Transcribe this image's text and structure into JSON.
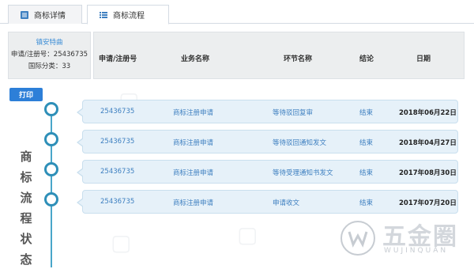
{
  "tabs": [
    {
      "label": "商标详情",
      "icon": "document-icon"
    },
    {
      "label": "商标流程",
      "icon": "list-icon"
    }
  ],
  "info": {
    "agent": "镇安特曲",
    "reg_label": "申请/注册号：25436735",
    "class_label": "国际分类：33"
  },
  "headers": {
    "number": "申请/注册号",
    "business": "业务名称",
    "step": "环节名称",
    "result": "结论",
    "date": "日期"
  },
  "print_label": "打印",
  "side_title": [
    "商",
    "标",
    "流",
    "程",
    "状",
    "态"
  ],
  "rows": [
    {
      "number": "25436735",
      "business": "商标注册申请",
      "step": "等待驳回复审",
      "result": "结束",
      "date": "2018年06月22日"
    },
    {
      "number": "25436735",
      "business": "商标注册申请",
      "step": "等待驳回通知发文",
      "result": "结束",
      "date": "2018年04月27日"
    },
    {
      "number": "25436735",
      "business": "商标注册申请",
      "step": "等待受理通知书发文",
      "result": "结束",
      "date": "2017年08月30日"
    },
    {
      "number": "25436735",
      "business": "商标注册申请",
      "step": "申请收文",
      "result": "结束",
      "date": "2017年07月20日"
    }
  ],
  "watermark": {
    "main": "五金圈",
    "sub": "WUJINQUAN"
  },
  "colors": {
    "accent": "#2d7fd8",
    "timeline": "#2e8fb8",
    "row_bg": "#e6f1f9"
  }
}
